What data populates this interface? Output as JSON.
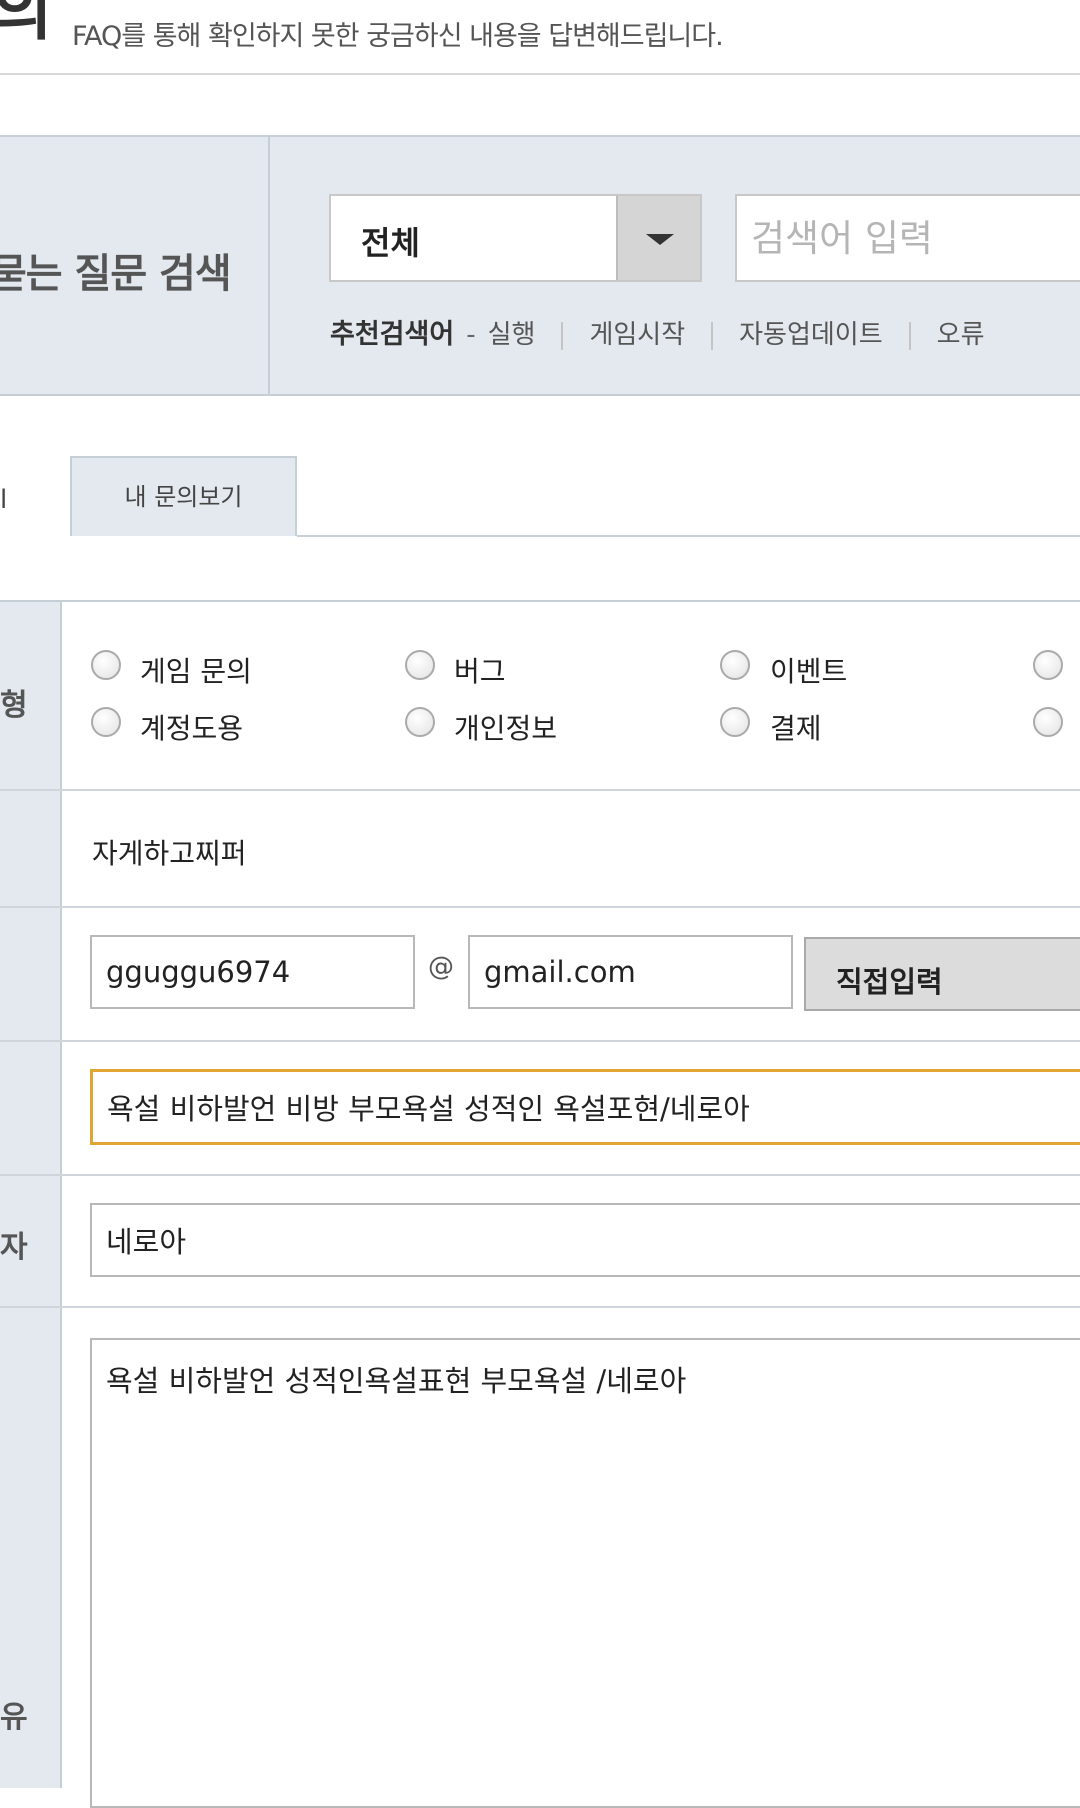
{
  "header": {
    "title_fragment": "의",
    "description": "FAQ를 통해 확인하지 못한 궁금하신 내용을 답변해드립니다."
  },
  "faq_search": {
    "title": "묻는 질문 검색",
    "category_select": {
      "value": "전체"
    },
    "search_input": {
      "placeholder": "검색어 입력",
      "value": ""
    },
    "recommended_label": "추천검색어",
    "recommended_items": [
      "실행",
      "게임시작",
      "자동업데이트",
      "오류"
    ]
  },
  "tabs": {
    "active_fragment": "l",
    "my_questions": "내 문의보기"
  },
  "form": {
    "type_label_fragment": "형",
    "radio_options": [
      {
        "label": "게임 문의",
        "checked": false
      },
      {
        "label": "버그",
        "checked": false
      },
      {
        "label": "이벤트",
        "checked": false
      },
      {
        "label": "",
        "checked": false
      },
      {
        "label": "계정도용",
        "checked": false
      },
      {
        "label": "개인정보",
        "checked": false
      },
      {
        "label": "결제",
        "checked": false
      },
      {
        "label": "",
        "checked": false
      }
    ],
    "character_name": "자게하고찌퍼",
    "email_id": "gguggu6974",
    "email_at": "@",
    "email_domain": "gmail.com",
    "domain_select": "직접입력",
    "subject": "욕설 비하발언 비방 부모욕설 성적인 욕설포현/네로아",
    "reporter_label_fragment": "자",
    "reporter": "네로아",
    "content_label_fragment": "유",
    "content": "욕설 비하발언 성적인욕설표현 부모욕설 /네로아"
  }
}
